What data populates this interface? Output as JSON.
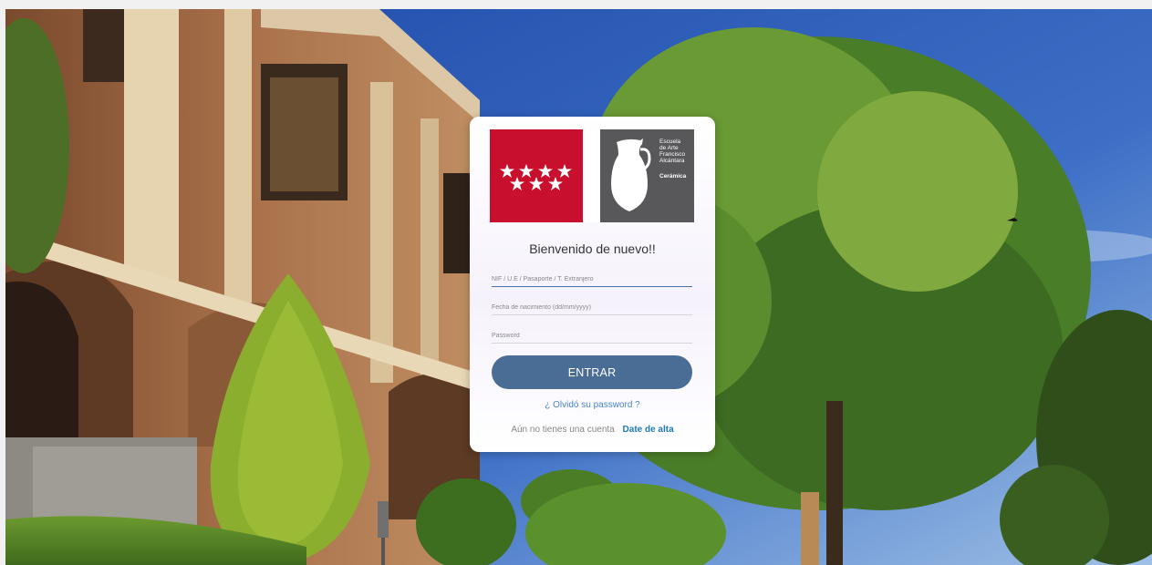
{
  "logo": {
    "school_name_lines": "Escuela\nde Arte\nFrancisco\nAlcántara",
    "school_subtitle": "Cerámica",
    "madrid_flag_icon": "seven-stars-icon",
    "school_icon": "pitcher-icon"
  },
  "login": {
    "welcome": "Bienvenido de nuevo!!",
    "id_placeholder": "NIF / U.E / Pasaporte / T. Extranjero",
    "birth_placeholder": "Fecha de nacimiento (dd/mm/yyyy)",
    "password_placeholder": "Password",
    "enter_label": "ENTRAR",
    "forgot_label": "¿ Olvidó su password ?",
    "no_account_label": "Aún no tienes una cuenta",
    "signup_label": "Date de alta"
  },
  "colors": {
    "madrid_red": "#c8102e",
    "school_gray": "#58575a",
    "button": "#4a6d96",
    "link": "#1f7ab5"
  }
}
